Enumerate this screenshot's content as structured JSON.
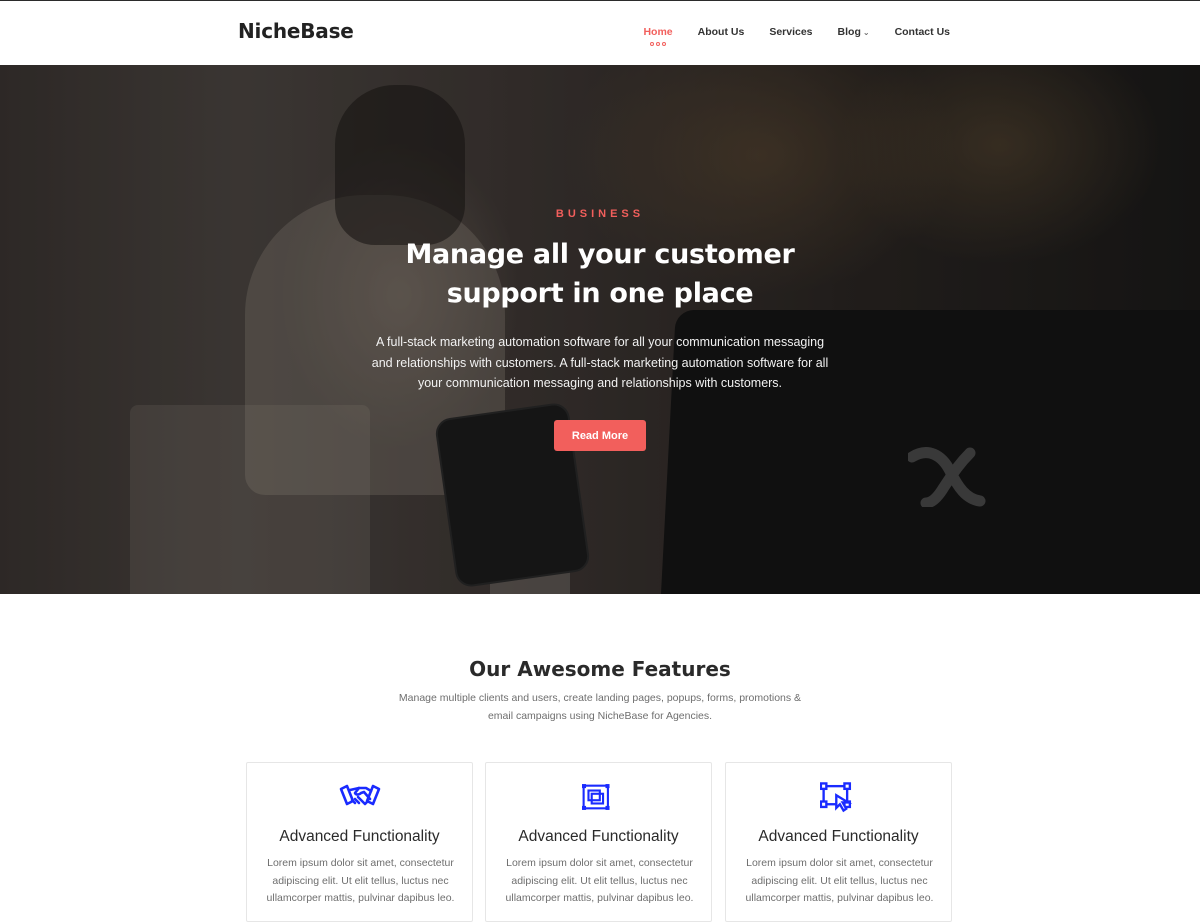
{
  "brand": "NicheBase",
  "nav": [
    {
      "label": "Home",
      "active": true
    },
    {
      "label": "About Us"
    },
    {
      "label": "Services"
    },
    {
      "label": "Blog",
      "has_dropdown": true
    },
    {
      "label": "Contact Us"
    }
  ],
  "hero": {
    "eyebrow": "BUSINESS",
    "title_line1": "Manage all your customer",
    "title_line2": "support in one place",
    "description": "A full-stack marketing automation software for all your communication messaging and relationships with customers. A full-stack marketing automation software for all your communication messaging and relationships with customers.",
    "button_label": "Read More"
  },
  "features": {
    "title": "Our Awesome Features",
    "subtitle": "Manage multiple clients and users, create landing pages, popups, forms, promotions & email campaigns using NicheBase for Agencies.",
    "cards": [
      {
        "icon": "handshake-icon",
        "title": "Advanced Functionality",
        "text": "Lorem ipsum dolor sit amet, consectetur adipiscing elit. Ut elit tellus, luctus nec ullamcorper mattis, pulvinar dapibus leo."
      },
      {
        "icon": "layers-square-icon",
        "title": "Advanced Functionality",
        "text": "Lorem ipsum dolor sit amet, consectetur adipiscing elit. Ut elit tellus, luctus nec ullamcorper mattis, pulvinar dapibus leo."
      },
      {
        "icon": "vector-shape-icon",
        "title": "Advanced Functionality",
        "text": "Lorem ipsum dolor sit amet, consectetur adipiscing elit. Ut elit tellus, luctus nec ullamcorper mattis, pulvinar dapibus leo."
      }
    ]
  },
  "colors": {
    "accent": "#f25f5c",
    "icon_blue": "#1a2bff"
  }
}
